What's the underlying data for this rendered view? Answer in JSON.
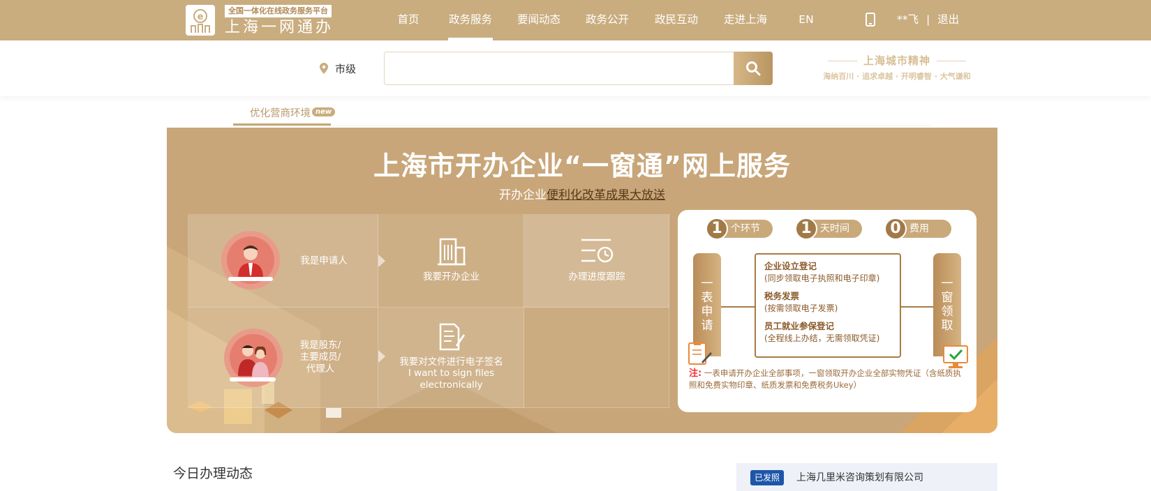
{
  "header": {
    "logo_tagline": "全国一体化在线政务服务平台",
    "logo_name": "上海一网通办",
    "nav": [
      {
        "label": "首页",
        "active": false
      },
      {
        "label": "政务服务",
        "active": true
      },
      {
        "label": "要闻动态",
        "active": false
      },
      {
        "label": "政务公开",
        "active": false
      },
      {
        "label": "政民互动",
        "active": false
      },
      {
        "label": "走进上海",
        "active": false
      },
      {
        "label": "EN",
        "active": false
      }
    ],
    "user_name": "**飞",
    "separator": "|",
    "logout": "退出"
  },
  "search": {
    "location": "市级",
    "placeholder": "",
    "spirit_title": "上海城市精神",
    "spirit_sub": "海纳百川 · 追求卓越 · 开明睿智 · 大气谦和"
  },
  "tab": {
    "label": "优化营商环境",
    "badge": "new"
  },
  "banner": {
    "title": "上海市开办企业“一窗通”网上服务",
    "subtitle_prefix": "开办企业",
    "subtitle_link": "便利化改革成果大放送",
    "cells": {
      "applicant": "我是申请人",
      "shareholder": [
        "我是股东/",
        "主要成员/",
        "代理人"
      ],
      "open_company": "我要开办企业",
      "progress": "办理进度跟踪",
      "e_sign_cn": "我要对文件进行电子签名",
      "e_sign_en": "I want to sign files electronically"
    }
  },
  "info_card": {
    "pills": [
      {
        "num": "1",
        "label": "个环节"
      },
      {
        "num": "1",
        "label": "天时间"
      },
      {
        "num": "0",
        "label": "费用"
      }
    ],
    "left_col": [
      "一",
      "表",
      "申",
      "请"
    ],
    "right_col": [
      "一",
      "窗",
      "领",
      "取"
    ],
    "items": [
      {
        "title": "企业设立登记",
        "desc": "(同步领取电子执照和电子印章)"
      },
      {
        "title": "税务发票",
        "desc": "(按需领取电子发票)"
      },
      {
        "title": "员工就业参保登记",
        "desc": "(全程线上办结，无需领取凭证)"
      }
    ],
    "note_label": "注:",
    "note_text": "一表申请开办企业全部事项，一窗领取开办企业全部实物凭证（含纸质执照和免费实物印章、纸质发票和免费税务Ukey）"
  },
  "bottom": {
    "today_title": "今日办理动态",
    "feed_badge": "已发照",
    "feed_company": "上海几里米咨询策划有限公司"
  },
  "colors": {
    "brand": "#c9ad7f",
    "banner": "#c8a679",
    "accent_dark": "#a87a45",
    "note_red": "#ee3333",
    "feed_badge": "#1f55a8"
  }
}
